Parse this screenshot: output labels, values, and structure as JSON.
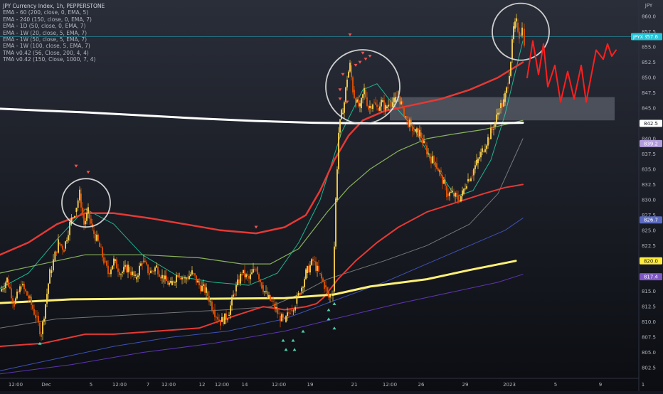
{
  "legend": {
    "title": "JPY Currency Index, 1h, PEPPERSTONE",
    "lines": [
      "EMA - 60 (200, close, 0, EMA, 5)",
      "EMA - 240 (150, close, 0, EMA, 7)",
      "EMA - 1D (50, close, 0, EMA, 7)",
      "EMA - 1W (20, close, 5, EMA, 7)",
      "EMA - 1W (50, close, 5, EMA, 7)",
      "EMA - 1W (100, close, 5, EMA, 7)",
      "TMA v0.42 (56, Close, 200, 4, 4)",
      "TMA v0.42 (150, Close, 1000, 7, 4)"
    ]
  },
  "chart_data": {
    "type": "candlestick",
    "currency": "JPY",
    "ylim": [
      801,
      862
    ],
    "y_ticks": [
      802.5,
      805.0,
      807.5,
      810.0,
      812.5,
      815.0,
      817.5,
      820.0,
      822.5,
      825.0,
      827.5,
      830.0,
      832.5,
      835.0,
      837.5,
      840.0,
      842.5,
      845.0,
      847.5,
      850.0,
      852.5,
      855.0,
      857.5,
      860.0
    ],
    "x_ticks": [
      "12:00",
      "Dec",
      "5",
      "12:00",
      "7",
      "12:00",
      "12",
      "12:00",
      "14",
      "12:00",
      "19",
      "21",
      "12:00",
      "26",
      "29",
      "2023",
      "5",
      "9",
      "1"
    ],
    "price_badges": [
      {
        "label": "857.6",
        "value": 856.7,
        "color": "#26c6da"
      },
      {
        "label": "842.5",
        "value": 842.5,
        "color": "#ffffff"
      },
      {
        "label": "839.2",
        "value": 839.2,
        "color": "#b39ddb"
      },
      {
        "label": "826.7",
        "value": 826.7,
        "color": "#5c6bc0"
      },
      {
        "label": "820.0",
        "value": 820.0,
        "color": "#ffeb3b"
      },
      {
        "label": "817.4",
        "value": 817.4,
        "color": "#7e57c2"
      }
    ],
    "symbol_tag": "JPYX",
    "current_price": 856.7,
    "resistance_zone": [
      843.0,
      846.8
    ],
    "series": {
      "price_close": [
        [
          0,
          815
        ],
        [
          10,
          817
        ],
        [
          20,
          813
        ],
        [
          30,
          816
        ],
        [
          40,
          814
        ],
        [
          50,
          811
        ],
        [
          58,
          808
        ],
        [
          64,
          813
        ],
        [
          70,
          818
        ],
        [
          75,
          820
        ],
        [
          82,
          823
        ],
        [
          90,
          822
        ],
        [
          98,
          826
        ],
        [
          105,
          828
        ],
        [
          112,
          831
        ],
        [
          118,
          826
        ],
        [
          124,
          828
        ],
        [
          130,
          825
        ],
        [
          138,
          823
        ],
        [
          146,
          820
        ],
        [
          152,
          818
        ],
        [
          160,
          820
        ],
        [
          170,
          818
        ],
        [
          180,
          819
        ],
        [
          190,
          817
        ],
        [
          200,
          820
        ],
        [
          210,
          818
        ],
        [
          220,
          819
        ],
        [
          230,
          817
        ],
        [
          240,
          816
        ],
        [
          250,
          818
        ],
        [
          260,
          817
        ],
        [
          270,
          818
        ],
        [
          280,
          816
        ],
        [
          290,
          815
        ],
        [
          300,
          812
        ],
        [
          310,
          810
        ],
        [
          320,
          811
        ],
        [
          330,
          815
        ],
        [
          340,
          818
        ],
        [
          350,
          817
        ],
        [
          360,
          819
        ],
        [
          368,
          816
        ],
        [
          376,
          814
        ],
        [
          384,
          813
        ],
        [
          392,
          811
        ],
        [
          400,
          810
        ],
        [
          408,
          812
        ],
        [
          415,
          813
        ],
        [
          422,
          815
        ],
        [
          430,
          818
        ],
        [
          440,
          820
        ],
        [
          448,
          818
        ],
        [
          456,
          816
        ],
        [
          462,
          814
        ],
        [
          468,
          815
        ],
        [
          472,
          830
        ],
        [
          476,
          841
        ],
        [
          480,
          844
        ],
        [
          484,
          846
        ],
        [
          488,
          850
        ],
        [
          492,
          852
        ],
        [
          496,
          848
        ],
        [
          500,
          846
        ],
        [
          506,
          845
        ],
        [
          512,
          848
        ],
        [
          518,
          845
        ],
        [
          524,
          846
        ],
        [
          530,
          845
        ],
        [
          536,
          846
        ],
        [
          542,
          845
        ],
        [
          548,
          846
        ],
        [
          554,
          846
        ],
        [
          560,
          847
        ],
        [
          566,
          845
        ],
        [
          572,
          843
        ],
        [
          578,
          842
        ],
        [
          584,
          841
        ],
        [
          590,
          841
        ],
        [
          596,
          839
        ],
        [
          604,
          837
        ],
        [
          612,
          836
        ],
        [
          620,
          834
        ],
        [
          628,
          831
        ],
        [
          636,
          831
        ],
        [
          644,
          830
        ],
        [
          650,
          831
        ],
        [
          656,
          833
        ],
        [
          662,
          834
        ],
        [
          670,
          836
        ],
        [
          678,
          838
        ],
        [
          686,
          840
        ],
        [
          694,
          842
        ],
        [
          702,
          845
        ],
        [
          708,
          846
        ],
        [
          714,
          849
        ],
        [
          718,
          853
        ],
        [
          722,
          858
        ],
        [
          726,
          859
        ],
        [
          730,
          857
        ],
        [
          734,
          858
        ],
        [
          737,
          856
        ]
      ],
      "white_thick": [
        [
          0,
          844.9
        ],
        [
          60,
          844.6
        ],
        [
          120,
          844.3
        ],
        [
          200,
          843.8
        ],
        [
          280,
          843.3
        ],
        [
          360,
          842.9
        ],
        [
          440,
          842.6
        ],
        [
          520,
          842.5
        ],
        [
          600,
          842.5
        ],
        [
          680,
          842.5
        ],
        [
          735,
          842.6
        ]
      ],
      "yellow_thick": [
        [
          0,
          813.1
        ],
        [
          100,
          813.7
        ],
        [
          200,
          813.8
        ],
        [
          300,
          813.8
        ],
        [
          400,
          813.9
        ],
        [
          470,
          814.5
        ],
        [
          520,
          815.8
        ],
        [
          600,
          817.0
        ],
        [
          660,
          818.5
        ],
        [
          725,
          820.0
        ]
      ],
      "red_upper": [
        [
          0,
          821
        ],
        [
          40,
          823
        ],
        [
          80,
          826
        ],
        [
          120,
          827.8
        ],
        [
          160,
          827.8
        ],
        [
          210,
          827.0
        ],
        [
          260,
          826.0
        ],
        [
          310,
          825.0
        ],
        [
          360,
          824.5
        ],
        [
          400,
          825.5
        ],
        [
          430,
          827.5
        ],
        [
          450,
          831.5
        ],
        [
          470,
          836.5
        ],
        [
          490,
          840.5
        ],
        [
          510,
          843.0
        ],
        [
          540,
          844.5
        ],
        [
          580,
          845.5
        ],
        [
          620,
          846.5
        ],
        [
          660,
          848.0
        ],
        [
          700,
          850.0
        ],
        [
          735,
          852.5
        ]
      ],
      "red_lower": [
        [
          0,
          806.0
        ],
        [
          60,
          806.5
        ],
        [
          120,
          808.0
        ],
        [
          160,
          808.0
        ],
        [
          220,
          808.5
        ],
        [
          280,
          809.0
        ],
        [
          330,
          811.0
        ],
        [
          370,
          812.5
        ],
        [
          400,
          812.0
        ],
        [
          430,
          812.5
        ],
        [
          445,
          813.0
        ],
        [
          455,
          814.0
        ],
        [
          475,
          817.0
        ],
        [
          500,
          820.0
        ],
        [
          530,
          823.0
        ],
        [
          560,
          825.5
        ],
        [
          600,
          828.0
        ],
        [
          640,
          829.5
        ],
        [
          680,
          831.0
        ],
        [
          710,
          832.0
        ],
        [
          735,
          832.5
        ]
      ],
      "teal_band": [
        [
          0,
          815.5
        ],
        [
          40,
          818.0
        ],
        [
          80,
          823.5
        ],
        [
          120,
          828.5
        ],
        [
          160,
          826.0
        ],
        [
          200,
          821.0
        ],
        [
          250,
          817.5
        ],
        [
          300,
          816.5
        ],
        [
          350,
          816.0
        ],
        [
          390,
          818.0
        ],
        [
          420,
          823.0
        ],
        [
          450,
          830.0
        ],
        [
          480,
          841.0
        ],
        [
          510,
          848.0
        ],
        [
          530,
          849.0
        ],
        [
          550,
          846.0
        ],
        [
          580,
          842.0
        ],
        [
          610,
          836.0
        ],
        [
          640,
          830.5
        ],
        [
          665,
          831.5
        ],
        [
          690,
          836.5
        ],
        [
          710,
          844.0
        ],
        [
          735,
          856.0
        ]
      ],
      "green_ma": [
        [
          0,
          818.0
        ],
        [
          60,
          819.5
        ],
        [
          120,
          821.0
        ],
        [
          200,
          821.0
        ],
        [
          280,
          820.5
        ],
        [
          340,
          819.5
        ],
        [
          380,
          819.5
        ],
        [
          420,
          822.0
        ],
        [
          460,
          828.0
        ],
        [
          490,
          832.0
        ],
        [
          520,
          835.0
        ],
        [
          560,
          838.0
        ],
        [
          600,
          840.0
        ],
        [
          640,
          840.8
        ],
        [
          680,
          841.5
        ],
        [
          710,
          842.3
        ],
        [
          735,
          843.0
        ]
      ],
      "gray_ma": [
        [
          0,
          809.0
        ],
        [
          80,
          810.5
        ],
        [
          160,
          811.0
        ],
        [
          240,
          811.5
        ],
        [
          320,
          812.0
        ],
        [
          380,
          812.5
        ],
        [
          420,
          814.5
        ],
        [
          460,
          817.0
        ],
        [
          500,
          818.5
        ],
        [
          540,
          820.0
        ],
        [
          600,
          822.5
        ],
        [
          660,
          826.0
        ],
        [
          700,
          831.0
        ],
        [
          735,
          840.0
        ]
      ],
      "blue_ma": [
        [
          0,
          802.0
        ],
        [
          80,
          804.0
        ],
        [
          160,
          806.0
        ],
        [
          240,
          807.5
        ],
        [
          320,
          808.5
        ],
        [
          400,
          810.5
        ],
        [
          470,
          813.5
        ],
        [
          540,
          816.5
        ],
        [
          600,
          819.5
        ],
        [
          660,
          822.5
        ],
        [
          710,
          825.0
        ],
        [
          735,
          827.0
        ]
      ],
      "purple_ma": [
        [
          0,
          801.5
        ],
        [
          100,
          803.0
        ],
        [
          200,
          805.0
        ],
        [
          300,
          806.5
        ],
        [
          400,
          808.5
        ],
        [
          470,
          810.5
        ],
        [
          560,
          813.0
        ],
        [
          640,
          815.0
        ],
        [
          700,
          816.5
        ],
        [
          735,
          817.8
        ]
      ],
      "projection": [
        [
          741,
          850.0
        ],
        [
          749,
          856.0
        ],
        [
          757,
          850.5
        ],
        [
          764,
          855.5
        ],
        [
          770,
          848.5
        ],
        [
          780,
          852.0
        ],
        [
          788,
          846.0
        ],
        [
          798,
          851.0
        ],
        [
          807,
          846.5
        ],
        [
          817,
          852.0
        ],
        [
          824,
          846.0
        ],
        [
          838,
          854.5
        ],
        [
          848,
          853.0
        ],
        [
          854,
          855.5
        ],
        [
          860,
          853.5
        ],
        [
          866,
          854.5
        ]
      ],
      "circles": [
        {
          "x": 121,
          "y": 829.5,
          "r": 34
        },
        {
          "x": 510,
          "y": 848.5,
          "r": 52
        },
        {
          "x": 732,
          "y": 857.5,
          "r": 40
        }
      ]
    }
  }
}
